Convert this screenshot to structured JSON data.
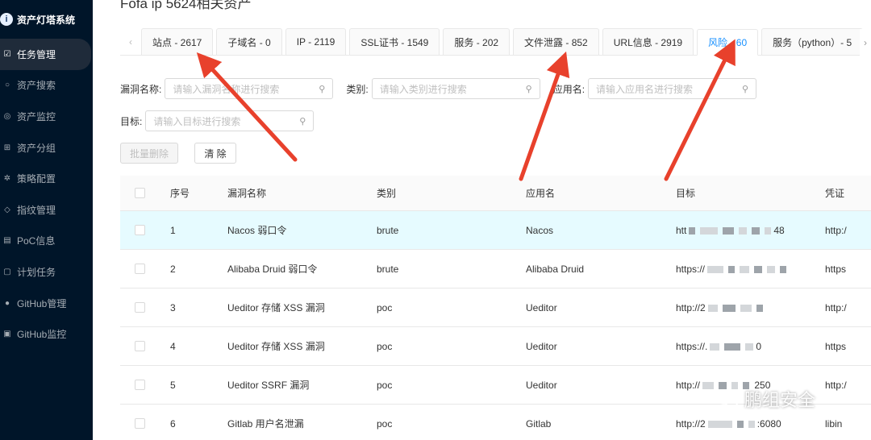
{
  "sidebar": {
    "brand": "资产灯塔系统",
    "items": [
      {
        "label": "任务管理",
        "icon": "tasks-icon",
        "active": true
      },
      {
        "label": "资产搜索",
        "icon": "search-icon",
        "active": false
      },
      {
        "label": "资产监控",
        "icon": "monitor-icon",
        "active": false
      },
      {
        "label": "资产分组",
        "icon": "group-icon",
        "active": false
      },
      {
        "label": "策略配置",
        "icon": "gear-icon",
        "active": false
      },
      {
        "label": "指纹管理",
        "icon": "fingerprint-icon",
        "active": false
      },
      {
        "label": "PoC信息",
        "icon": "document-icon",
        "active": false
      },
      {
        "label": "计划任务",
        "icon": "schedule-icon",
        "active": false
      },
      {
        "label": "GitHub管理",
        "icon": "github-icon",
        "active": false
      },
      {
        "label": "GitHub监控",
        "icon": "github-icon",
        "active": false
      }
    ]
  },
  "page": {
    "title": "Fofa ip 5624相关资产"
  },
  "tabs": [
    {
      "label": "站点 - 2617"
    },
    {
      "label": "子域名 - 0"
    },
    {
      "label": "IP - 2119"
    },
    {
      "label": "SSL证书 - 1549"
    },
    {
      "label": "服务 - 202"
    },
    {
      "label": "文件泄露 - 852"
    },
    {
      "label": "URL信息 - 2919"
    },
    {
      "label": "风险 - 60",
      "active": true
    },
    {
      "label": "服务（python）- 5"
    }
  ],
  "filters": {
    "vuln_name": {
      "label": "漏洞名称:",
      "placeholder": "请输入漏洞名称进行搜索"
    },
    "category": {
      "label": "类别:",
      "placeholder": "请输入类别进行搜索"
    },
    "app_name": {
      "label": "应用名:",
      "placeholder": "请输入应用名进行搜索"
    },
    "target": {
      "label": "目标:",
      "placeholder": "请输入目标进行搜索"
    }
  },
  "buttons": {
    "batch_delete": "批量删除",
    "clear": "清 除"
  },
  "table": {
    "headers": {
      "index": "序号",
      "name": "漏洞名称",
      "type": "类别",
      "app": "应用名",
      "target": "目标",
      "cred": "凭证"
    },
    "rows": [
      {
        "index": "1",
        "name": "Nacos 弱口令",
        "type": "brute",
        "app": "Nacos",
        "target_prefix": "htt",
        "target_suffix": "48",
        "cred": "http:/"
      },
      {
        "index": "2",
        "name": "Alibaba Druid 弱口令",
        "type": "brute",
        "app": "Alibaba Druid",
        "target_prefix": "https://",
        "target_suffix": "",
        "cred": "https"
      },
      {
        "index": "3",
        "name": "Ueditor 存储 XSS 漏洞",
        "type": "poc",
        "app": "Ueditor",
        "target_prefix": "http://2",
        "target_suffix": "",
        "cred": "http:/"
      },
      {
        "index": "4",
        "name": "Ueditor 存储 XSS 漏洞",
        "type": "poc",
        "app": "Ueditor",
        "target_prefix": "https://.",
        "target_suffix": "0",
        "cred": "https"
      },
      {
        "index": "5",
        "name": "Ueditor SSRF 漏洞",
        "type": "poc",
        "app": "Ueditor",
        "target_prefix": "http://",
        "target_suffix": "250",
        "cred": "http:/"
      },
      {
        "index": "6",
        "name": "Gitlab 用户名泄漏",
        "type": "poc",
        "app": "Gitlab",
        "target_prefix": "http://2",
        "target_suffix": ":6080",
        "cred": "libin"
      }
    ]
  },
  "watermark": {
    "text": "鹏组安全"
  },
  "colors": {
    "sidebar_bg": "#001529",
    "accent": "#1890ff",
    "annotation_red": "#e8412c",
    "highlight_row": "#e6fbff"
  }
}
